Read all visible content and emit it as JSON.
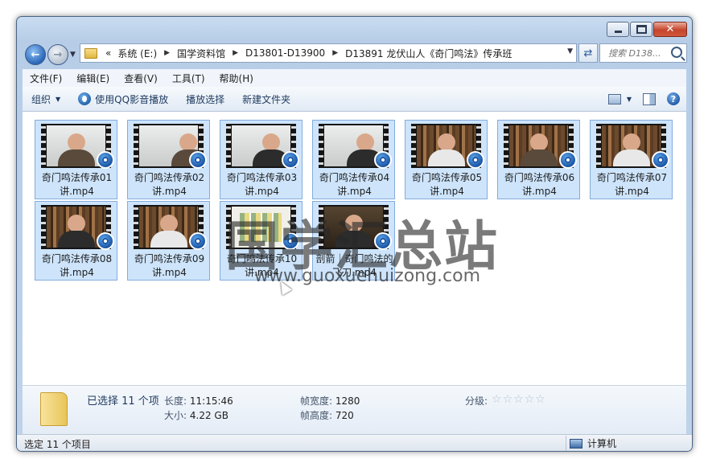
{
  "address": {
    "prefix": "«",
    "crumbs": [
      "系统 (E:)",
      "国学资料馆",
      "D13801-D13900",
      "D13891 龙伏山人《奇门鸣法》传承班"
    ]
  },
  "search": {
    "placeholder": "搜索 D138..."
  },
  "menu": [
    "文件(F)",
    "编辑(E)",
    "查看(V)",
    "工具(T)",
    "帮助(H)"
  ],
  "toolbar": {
    "organize": "组织",
    "qq_play": "使用QQ影音播放",
    "play_selection": "播放选择",
    "new_folder": "新建文件夹"
  },
  "files": [
    {
      "name": "奇门鸣法传承01讲.mp4"
    },
    {
      "name": "奇门鸣法传承02讲.mp4"
    },
    {
      "name": "奇门鸣法传承03讲.mp4"
    },
    {
      "name": "奇门鸣法传承04讲.mp4"
    },
    {
      "name": "奇门鸣法传承05讲.mp4"
    },
    {
      "name": "奇门鸣法传承06讲.mp4"
    },
    {
      "name": "奇门鸣法传承07讲.mp4"
    },
    {
      "name": "奇门鸣法传承08讲.mp4"
    },
    {
      "name": "奇门鸣法传承09讲.mp4"
    },
    {
      "name": "奇门鸣法传承10讲.mp4"
    },
    {
      "name": "剖箭｜奇门鸣法的飞刀.mp4"
    }
  ],
  "watermark": {
    "text": "国学汇总站",
    "url": "www.guoxuehuizong.com"
  },
  "details": {
    "selected": "已选择 11 个项",
    "length_label": "长度:",
    "length_value": "11:15:46",
    "size_label": "大小:",
    "size_value": "4.22 GB",
    "width_label": "帧宽度:",
    "width_value": "1280",
    "height_label": "帧高度:",
    "height_value": "720",
    "rating_label": "分级:"
  },
  "status": {
    "left": "选定 11 个项目",
    "right": "计算机"
  }
}
